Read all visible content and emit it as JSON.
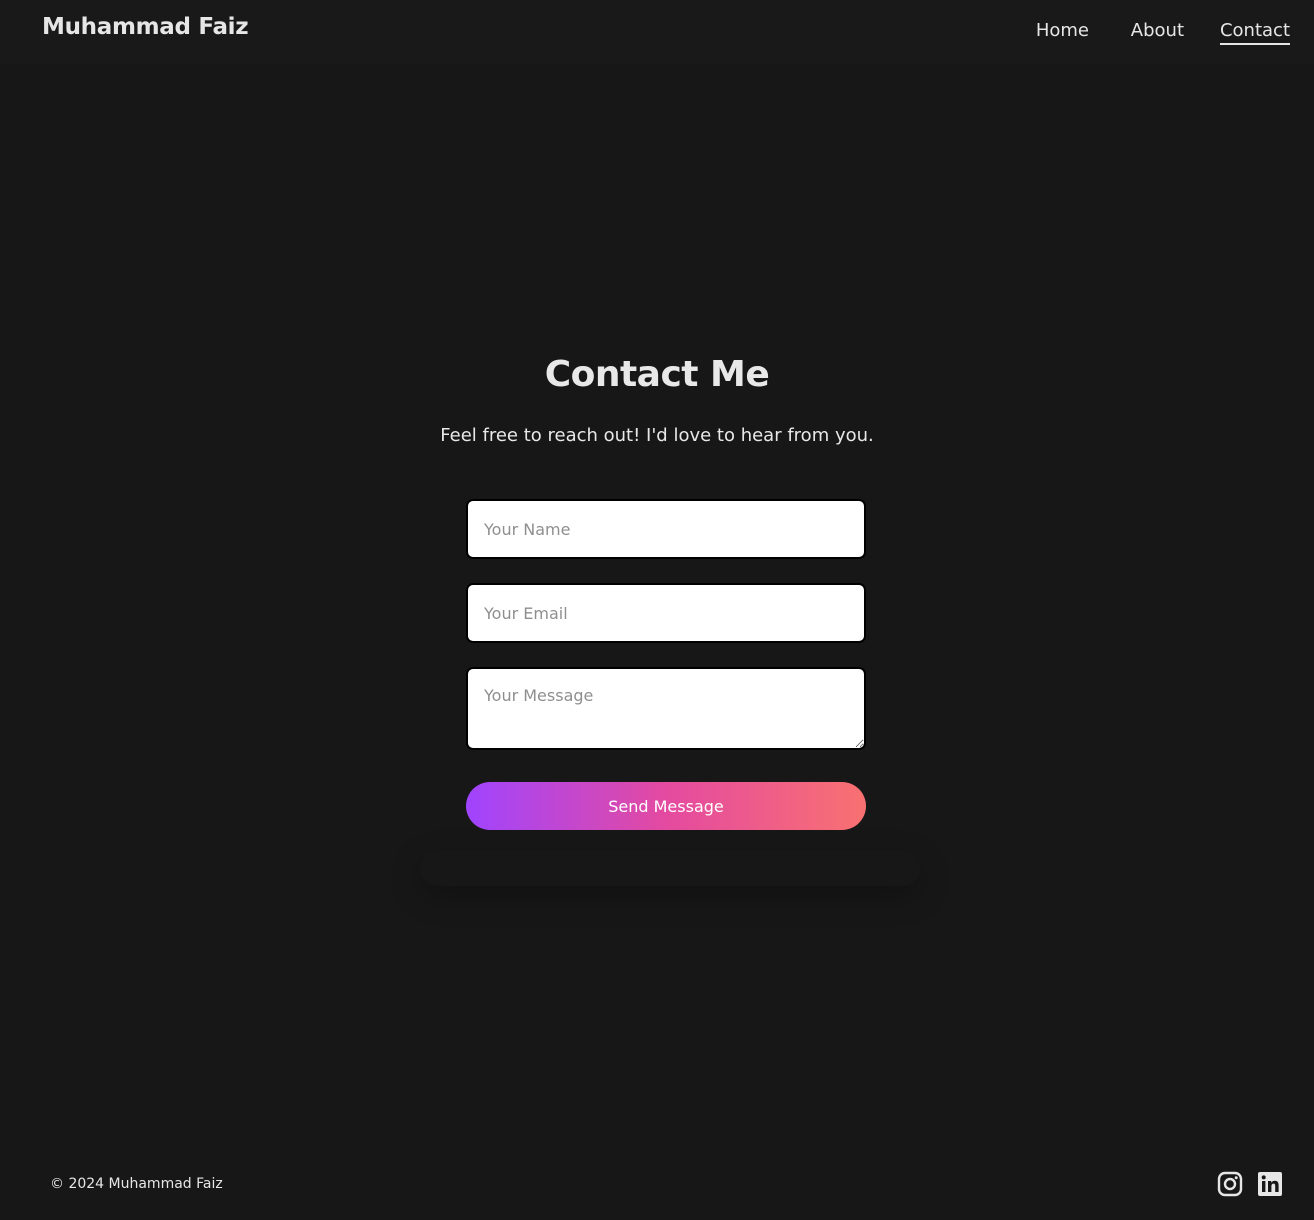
{
  "header": {
    "brand": "Muhammad Faiz",
    "nav": [
      {
        "label": "Home"
      },
      {
        "label": "About"
      },
      {
        "label": "Contact",
        "active": true
      }
    ]
  },
  "contact": {
    "title": "Contact Me",
    "subtitle": "Feel free to reach out! I'd love to hear from you.",
    "fields": {
      "name": {
        "placeholder": "Your Name",
        "value": ""
      },
      "email": {
        "placeholder": "Your Email",
        "value": ""
      },
      "message": {
        "placeholder": "Your Message",
        "value": ""
      }
    },
    "submit_label": "Send Message"
  },
  "footer": {
    "copyright": "© 2024 Muhammad Faiz",
    "social_icons": [
      "instagram-icon",
      "linkedin-icon"
    ]
  },
  "colors": {
    "background": "#171717",
    "header_background": "#191919",
    "text": "#e6e6e6",
    "button_gradient": [
      "#a044ff",
      "#e44aa0",
      "#f97171"
    ]
  }
}
